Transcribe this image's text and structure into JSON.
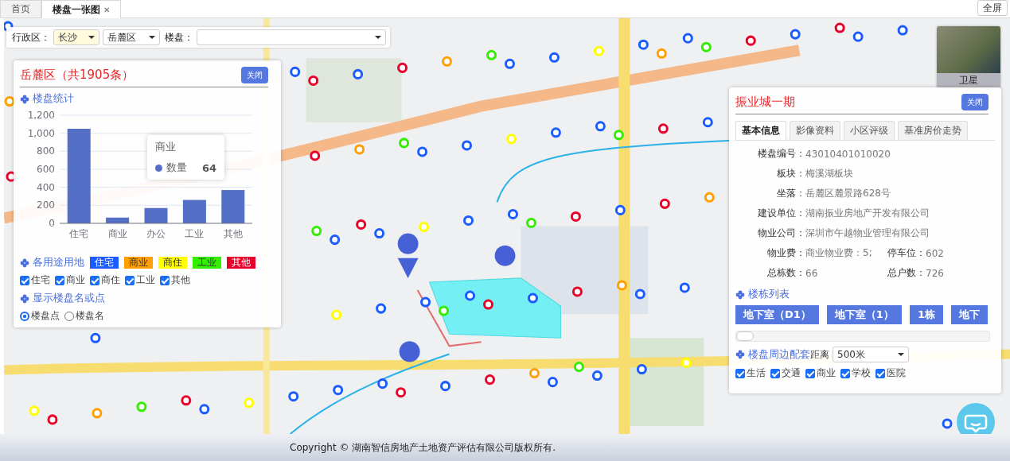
{
  "tabs": [
    {
      "label": "首页",
      "selected": false,
      "closable": false
    },
    {
      "label": "楼盘一张图",
      "selected": true,
      "closable": true
    }
  ],
  "close_tab_icon": "✕",
  "fullscreen_button": "全屏",
  "filter": {
    "district_label": "行政区：",
    "city": "长沙",
    "district": "岳麓区",
    "estate_label": "楼盘："
  },
  "satellite_toggle": {
    "label": "卫星"
  },
  "stats_panel": {
    "title": "岳麓区（共1905条）",
    "close": "关闭",
    "section_stats": "楼盘统计",
    "chart_data": {
      "type": "bar",
      "categories": [
        "住宅",
        "商业",
        "办公",
        "工业",
        "其他"
      ],
      "series": [
        {
          "name": "数量",
          "color": "#5470c6",
          "values": [
            1050,
            64,
            170,
            260,
            370
          ]
        }
      ],
      "ylim": [
        0,
        1200
      ],
      "grid": true,
      "yticks": [
        0,
        {
          "value": 200,
          "label": "200"
        },
        {
          "value": 400,
          "label": "400"
        },
        {
          "value": 600,
          "label": "600"
        },
        {
          "value": 800,
          "label": "800"
        },
        {
          "value": 1000,
          "label": "1,000"
        },
        {
          "value": 1200,
          "label": "1,200"
        }
      ]
    },
    "tooltip": {
      "category": "商业",
      "value": "64"
    },
    "section_landuse": "各用途用地",
    "legend": [
      {
        "label": "住宅",
        "color": "#1a5cff"
      },
      {
        "label": "商业",
        "color": "#ff9f00"
      },
      {
        "label": "商住",
        "color": "#ffff00"
      },
      {
        "label": "工业",
        "color": "#33ee00"
      },
      {
        "label": "其他",
        "color": "#e8002a"
      }
    ],
    "filters": [
      {
        "label": "住宅",
        "checked": true
      },
      {
        "label": "商业",
        "checked": true
      },
      {
        "label": "商住",
        "checked": true
      },
      {
        "label": "工业",
        "checked": true
      },
      {
        "label": "其他",
        "checked": true
      }
    ],
    "section_display": "显示楼盘名或点",
    "display_options": [
      {
        "label": "楼盘点",
        "selected": true
      },
      {
        "label": "楼盘名",
        "selected": false
      }
    ]
  },
  "detail_panel": {
    "title": "振业城一期",
    "close": "关闭",
    "tabs": [
      {
        "label": "基本信息",
        "selected": true
      },
      {
        "label": "影像资料",
        "selected": false
      },
      {
        "label": "小区评级",
        "selected": false
      },
      {
        "label": "基准房价走势",
        "selected": false
      }
    ],
    "info": [
      {
        "label": "楼盘编号：",
        "value": "43010401010020"
      },
      {
        "label": "板块：",
        "value": "梅溪湖板块"
      },
      {
        "label": "坐落：",
        "value": "岳麓区麓景路628号"
      },
      {
        "label": "建设单位：",
        "value": "湖南振业房地产开发有限公司"
      },
      {
        "label": "物业公司：",
        "value": "深圳市午越物业管理有限公司"
      }
    ],
    "info_pairs": [
      [
        {
          "label": "物业费：",
          "value": "商业物业费：5;"
        },
        {
          "label": "停车位：",
          "value": "602"
        }
      ],
      [
        {
          "label": "总栋数：",
          "value": "66"
        },
        {
          "label": "总户数：",
          "value": "726"
        }
      ]
    ],
    "section_buildings": "楼栋列表",
    "buildings": [
      "地下室（D1）",
      "地下室（1）",
      "1栋",
      "地下"
    ],
    "section_facilities": "楼盘周边配套",
    "distance_label": "距离",
    "distance": "500米",
    "facilities": [
      {
        "label": "生活",
        "checked": true
      },
      {
        "label": "交通",
        "checked": true
      },
      {
        "label": "商业",
        "checked": true
      },
      {
        "label": "学校",
        "checked": true
      },
      {
        "label": "医院",
        "checked": true
      }
    ]
  },
  "footer": "Copyright © 湖南智信房地产土地资产评估有限公司版权所有."
}
